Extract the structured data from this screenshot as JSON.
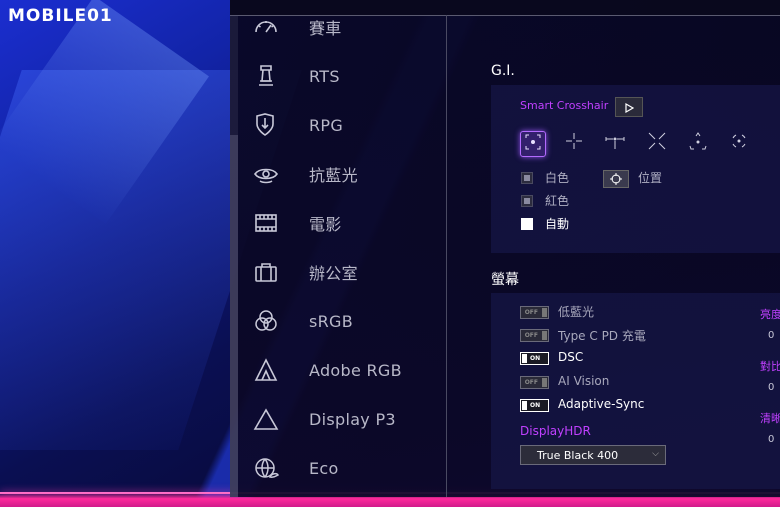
{
  "watermark": {
    "brand": "MOBILE01"
  },
  "sidebar": {
    "items": [
      {
        "label": "賽車",
        "icon": "speedometer-icon"
      },
      {
        "label": "RTS",
        "icon": "chess-rook-icon"
      },
      {
        "label": "RPG",
        "icon": "shield-sword-icon"
      },
      {
        "label": "抗藍光",
        "icon": "eye-icon"
      },
      {
        "label": "電影",
        "icon": "film-strip-icon"
      },
      {
        "label": "辦公室",
        "icon": "briefcase-icon"
      },
      {
        "label": "sRGB",
        "icon": "color-circles-icon"
      },
      {
        "label": "Adobe RGB",
        "icon": "adobe-a-icon"
      },
      {
        "label": "Display P3",
        "icon": "triangle-icon"
      },
      {
        "label": "Eco",
        "icon": "globe-leaf-icon"
      }
    ]
  },
  "gi": {
    "title": "G.I.",
    "smart_crosshair_label": "Smart Crosshair",
    "crosshair_icons": [
      "crosshair-circle-dot-icon",
      "crosshair-plus-icon",
      "crosshair-bracket-icon",
      "crosshair-x-icon",
      "crosshair-triangle-icon",
      "crosshair-ring-icon"
    ],
    "color_options": [
      {
        "label": "白色",
        "selected": false
      },
      {
        "label": "紅色",
        "selected": false
      },
      {
        "label": "自動",
        "selected": true
      }
    ],
    "position_label": "位置"
  },
  "monitor": {
    "title": "螢幕",
    "toggles": [
      {
        "label": "低藍光",
        "state": "OFF"
      },
      {
        "label": "Type C PD 充電",
        "state": "OFF"
      },
      {
        "label": "DSC",
        "state": "ON"
      },
      {
        "label": "AI Vision",
        "state": "OFF"
      },
      {
        "label": "Adaptive-Sync",
        "state": "ON"
      }
    ],
    "hdr_label": "DisplayHDR",
    "hdr_value": "True Black 400",
    "right_labels": [
      {
        "label": "亮度",
        "value": "0"
      },
      {
        "label": "對比",
        "value": "0"
      },
      {
        "label": "清晰",
        "value": "0"
      }
    ]
  },
  "colors": {
    "accent_purple": "#c040ff",
    "floor_pink": "#ff2a9c",
    "panel_bg": "#0c0828"
  }
}
